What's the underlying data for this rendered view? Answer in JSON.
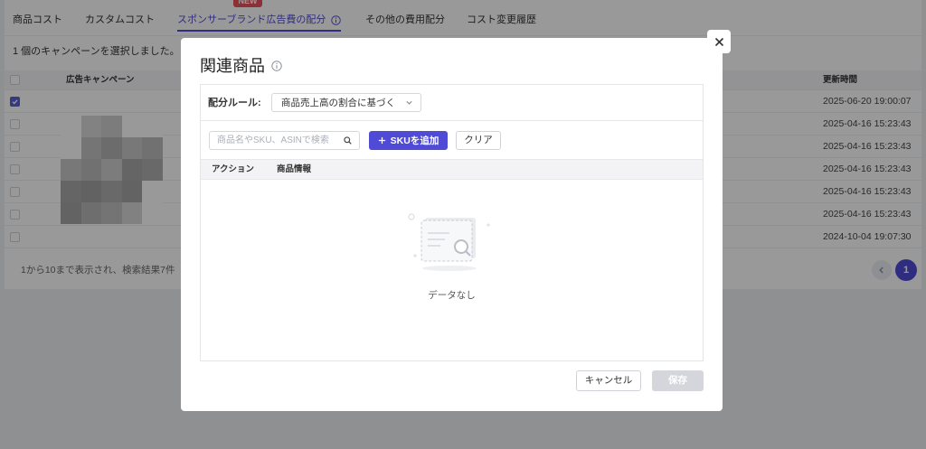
{
  "colors": {
    "accent": "#4f4bd6",
    "new_badge": "#e8505b",
    "checkbox_checked": "#5a5fd6",
    "save_disabled": "#d5d6dc"
  },
  "tabs": {
    "new_badge": "NEW",
    "items": [
      {
        "label": "商品コスト",
        "active": false
      },
      {
        "label": "カスタムコスト",
        "active": false
      },
      {
        "label": "スポンサーブランド広告費の配分",
        "active": true,
        "icon": "info-icon"
      },
      {
        "label": "その他の費用配分",
        "active": false
      },
      {
        "label": "コスト変更履歴",
        "active": false
      }
    ]
  },
  "selection_summary": "1 個のキャンペーンを選択しました。",
  "campaign_table": {
    "header_checked": false,
    "columns": {
      "campaign": "広告キャンペーン",
      "updated_at": "更新時間"
    },
    "rows": [
      {
        "checked": true,
        "updated_at": "2025-06-20 19:00:07"
      },
      {
        "checked": false,
        "updated_at": "2025-04-16 15:23:43"
      },
      {
        "checked": false,
        "updated_at": "2025-04-16 15:23:43"
      },
      {
        "checked": false,
        "updated_at": "2025-04-16 15:23:43"
      },
      {
        "checked": false,
        "updated_at": "2025-04-16 15:23:43"
      },
      {
        "checked": false,
        "updated_at": "2025-04-16 15:23:43"
      },
      {
        "checked": false,
        "updated_at": "2024-10-04 19:07:30"
      }
    ]
  },
  "pagination": {
    "summary": "1から10まで表示され、検索結果7件",
    "prev_icon": "chevron-left-icon",
    "current_page": "1"
  },
  "modal": {
    "title": "関連商品",
    "title_icon": "info-icon",
    "close_icon": "close-icon",
    "allocation_rule": {
      "label": "配分ルール:",
      "value": "商品売上高の割合に基づく",
      "icon": "chevron-down-icon"
    },
    "search": {
      "placeholder": "商品名やSKU、ASINで検索",
      "value": "",
      "icon": "search-icon"
    },
    "add_sku_button": {
      "label": "SKUを追加",
      "icon": "plus-icon"
    },
    "clear_button": {
      "label": "クリア"
    },
    "table_columns": [
      "アクション",
      "商品情報"
    ],
    "empty_state": {
      "text": "データなし",
      "icon": "empty-search-illustration"
    },
    "cancel_button": {
      "label": "キャンセル"
    },
    "save_button": {
      "label": "保存",
      "disabled": true
    }
  }
}
